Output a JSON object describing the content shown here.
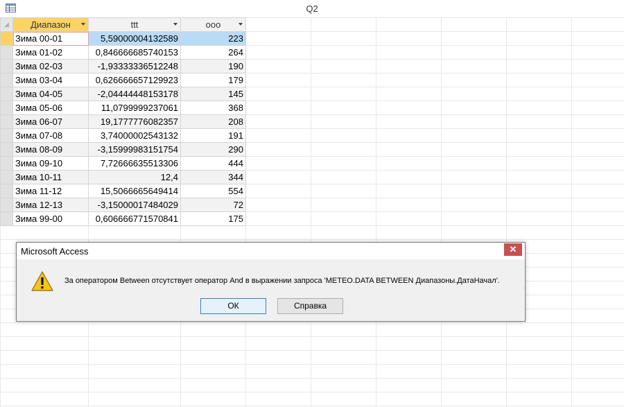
{
  "window": {
    "title": "Q2"
  },
  "table": {
    "columns": [
      "Диапазон",
      "ttt",
      "ooo"
    ],
    "rows": [
      [
        "Зима 00-01",
        "5,59000004132589",
        "223"
      ],
      [
        "Зима 01-02",
        "0,846666685740153",
        "264"
      ],
      [
        "Зима 02-03",
        "-1,93333336512248",
        "190"
      ],
      [
        "Зима 03-04",
        "0,626666657129923",
        "179"
      ],
      [
        "Зима 04-05",
        "-2,04444448153178",
        "145"
      ],
      [
        "Зима 05-06",
        "11,0799999237061",
        "368"
      ],
      [
        "Зима 06-07",
        "19,1777776082357",
        "208"
      ],
      [
        "Зима 07-08",
        "3,74000002543132",
        "191"
      ],
      [
        "Зима 08-09",
        "-3,15999983151754",
        "290"
      ],
      [
        "Зима 09-10",
        "7,72666635513306",
        "444"
      ],
      [
        "Зима 10-11",
        "12,4",
        "344"
      ],
      [
        "Зима 11-12",
        "15,5066665649414",
        "554"
      ],
      [
        "Зима 12-13",
        "-3,15000017484029",
        "72"
      ],
      [
        "Зима 99-00",
        "0,606666771570841",
        "175"
      ]
    ]
  },
  "dialog": {
    "title": "Microsoft Access",
    "close_label": "✕",
    "message": "За оператором Between отсутствует оператор And в выражении запроса 'METEO.DATA BETWEEN Диапазоны.ДатаНачал'.",
    "ok_label": "ОК",
    "help_label": "Справка"
  },
  "colors": {
    "active_header": "#fbd365",
    "selection": "#b9dbf7",
    "close_button": "#c75050"
  }
}
